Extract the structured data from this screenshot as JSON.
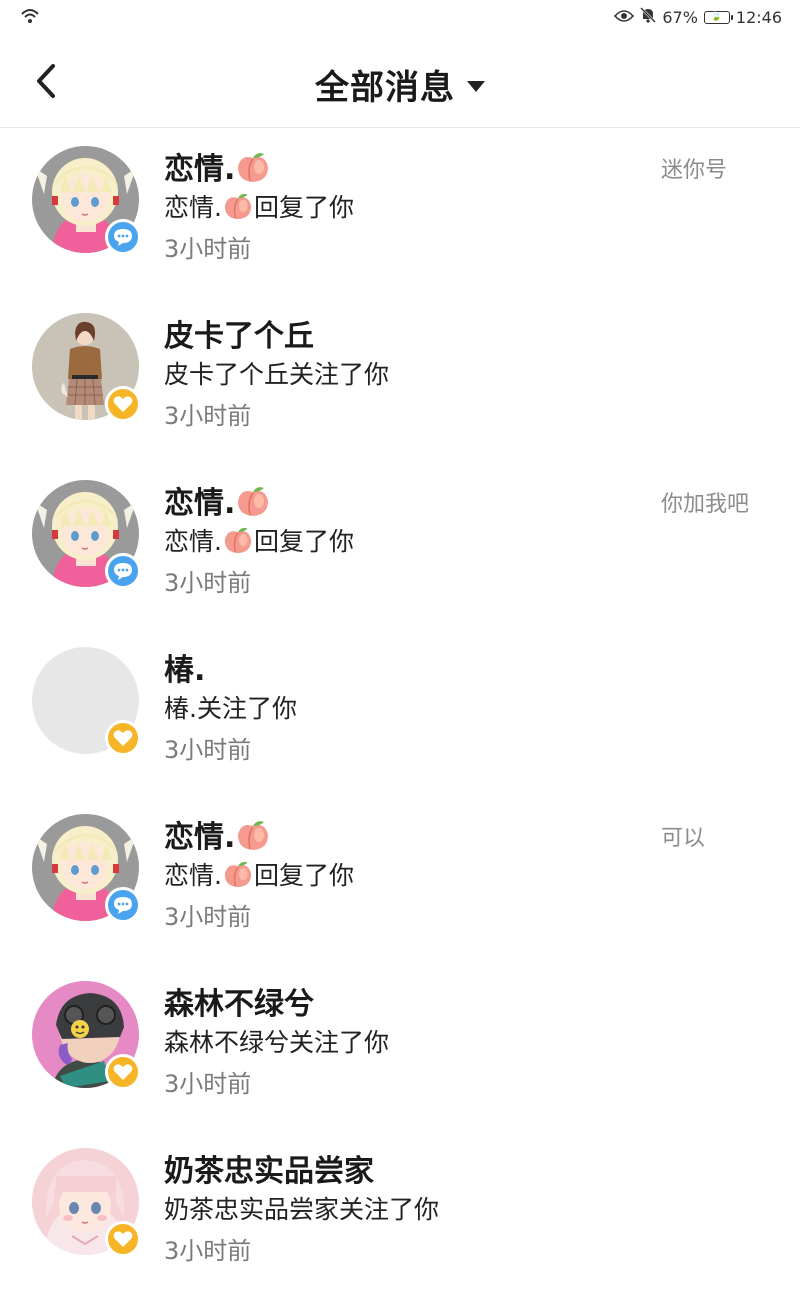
{
  "status_bar": {
    "battery": "67%",
    "time": "12:46"
  },
  "header": {
    "title": "全部消息"
  },
  "messages": [
    {
      "name": "恋情.",
      "name_emoji": "peach",
      "action_prefix": "恋情.",
      "action_emoji": "peach",
      "action": "回复了你",
      "time": "3小时前",
      "side_text": "迷你号",
      "badge": "comment-icon",
      "avatar": "anime-girl-horns"
    },
    {
      "name": "皮卡了个丘",
      "action_prefix": "皮卡了个丘关注了你",
      "time": "3小时前",
      "side_text": "",
      "badge": "heart-icon",
      "avatar": "girl-photo"
    },
    {
      "name": "恋情.",
      "name_emoji": "peach",
      "action_prefix": "恋情.",
      "action_emoji": "peach",
      "action": "回复了你",
      "time": "3小时前",
      "side_text": "你加我吧",
      "badge": "comment-icon",
      "avatar": "anime-girl-horns"
    },
    {
      "name": "椿.",
      "action_prefix": "椿.关注了你",
      "time": "3小时前",
      "side_text": "",
      "badge": "heart-icon",
      "avatar": "empty"
    },
    {
      "name": "恋情.",
      "name_emoji": "peach",
      "action_prefix": "恋情.",
      "action_emoji": "peach",
      "action": "回复了你",
      "time": "3小时前",
      "side_text": "可以",
      "badge": "comment-icon",
      "avatar": "anime-girl-horns"
    },
    {
      "name": "森林不绿兮",
      "action_prefix": "森林不绿兮关注了你",
      "time": "3小时前",
      "side_text": "",
      "badge": "heart-icon",
      "avatar": "helmet-character"
    },
    {
      "name": "奶茶忠实品尝家",
      "action_prefix": "奶茶忠实品尝家关注了你",
      "time": "3小时前",
      "side_text": "",
      "badge": "heart-icon",
      "avatar": "pink-anime-girl"
    }
  ],
  "colors": {
    "reply_badge": "#4aa3ee",
    "follow_badge": "#f6b526",
    "time_text": "#7a7a7a",
    "side_text": "#8c8c8c"
  }
}
